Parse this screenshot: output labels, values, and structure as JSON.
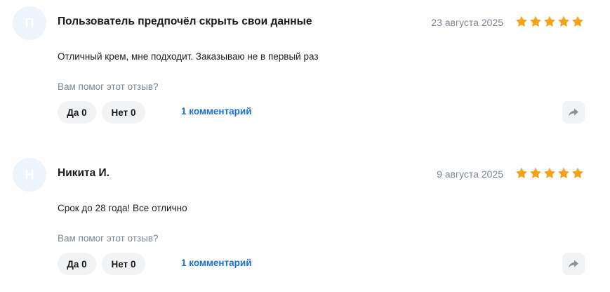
{
  "colors": {
    "star": "#f7a21b",
    "link": "#1b6fd8",
    "muted": "#7c8692",
    "chip_bg": "#f2f3f5",
    "avatar_bg": "#eef4fb"
  },
  "reviews": [
    {
      "avatar_letter": "П",
      "author": "Пользователь предпочёл скрыть свои данные",
      "date": "23 августа 2025",
      "rating": 5,
      "text": "Отличный крем, мне подходит. Заказываю не в первый раз",
      "helpful_prompt": "Вам помог этот отзыв?",
      "yes_label": "Да 0",
      "no_label": "Нет 0",
      "comments_label": "1 комментарий",
      "share_icon": "share-arrow-icon"
    },
    {
      "avatar_letter": "Н",
      "author": "Никита И.",
      "date": "9 августа 2025",
      "rating": 5,
      "text": "Срок до 28 года! Все отлично",
      "helpful_prompt": "Вам помог этот отзыв?",
      "yes_label": "Да 0",
      "no_label": "Нет 0",
      "comments_label": "1 комментарий",
      "share_icon": "share-arrow-icon"
    }
  ]
}
